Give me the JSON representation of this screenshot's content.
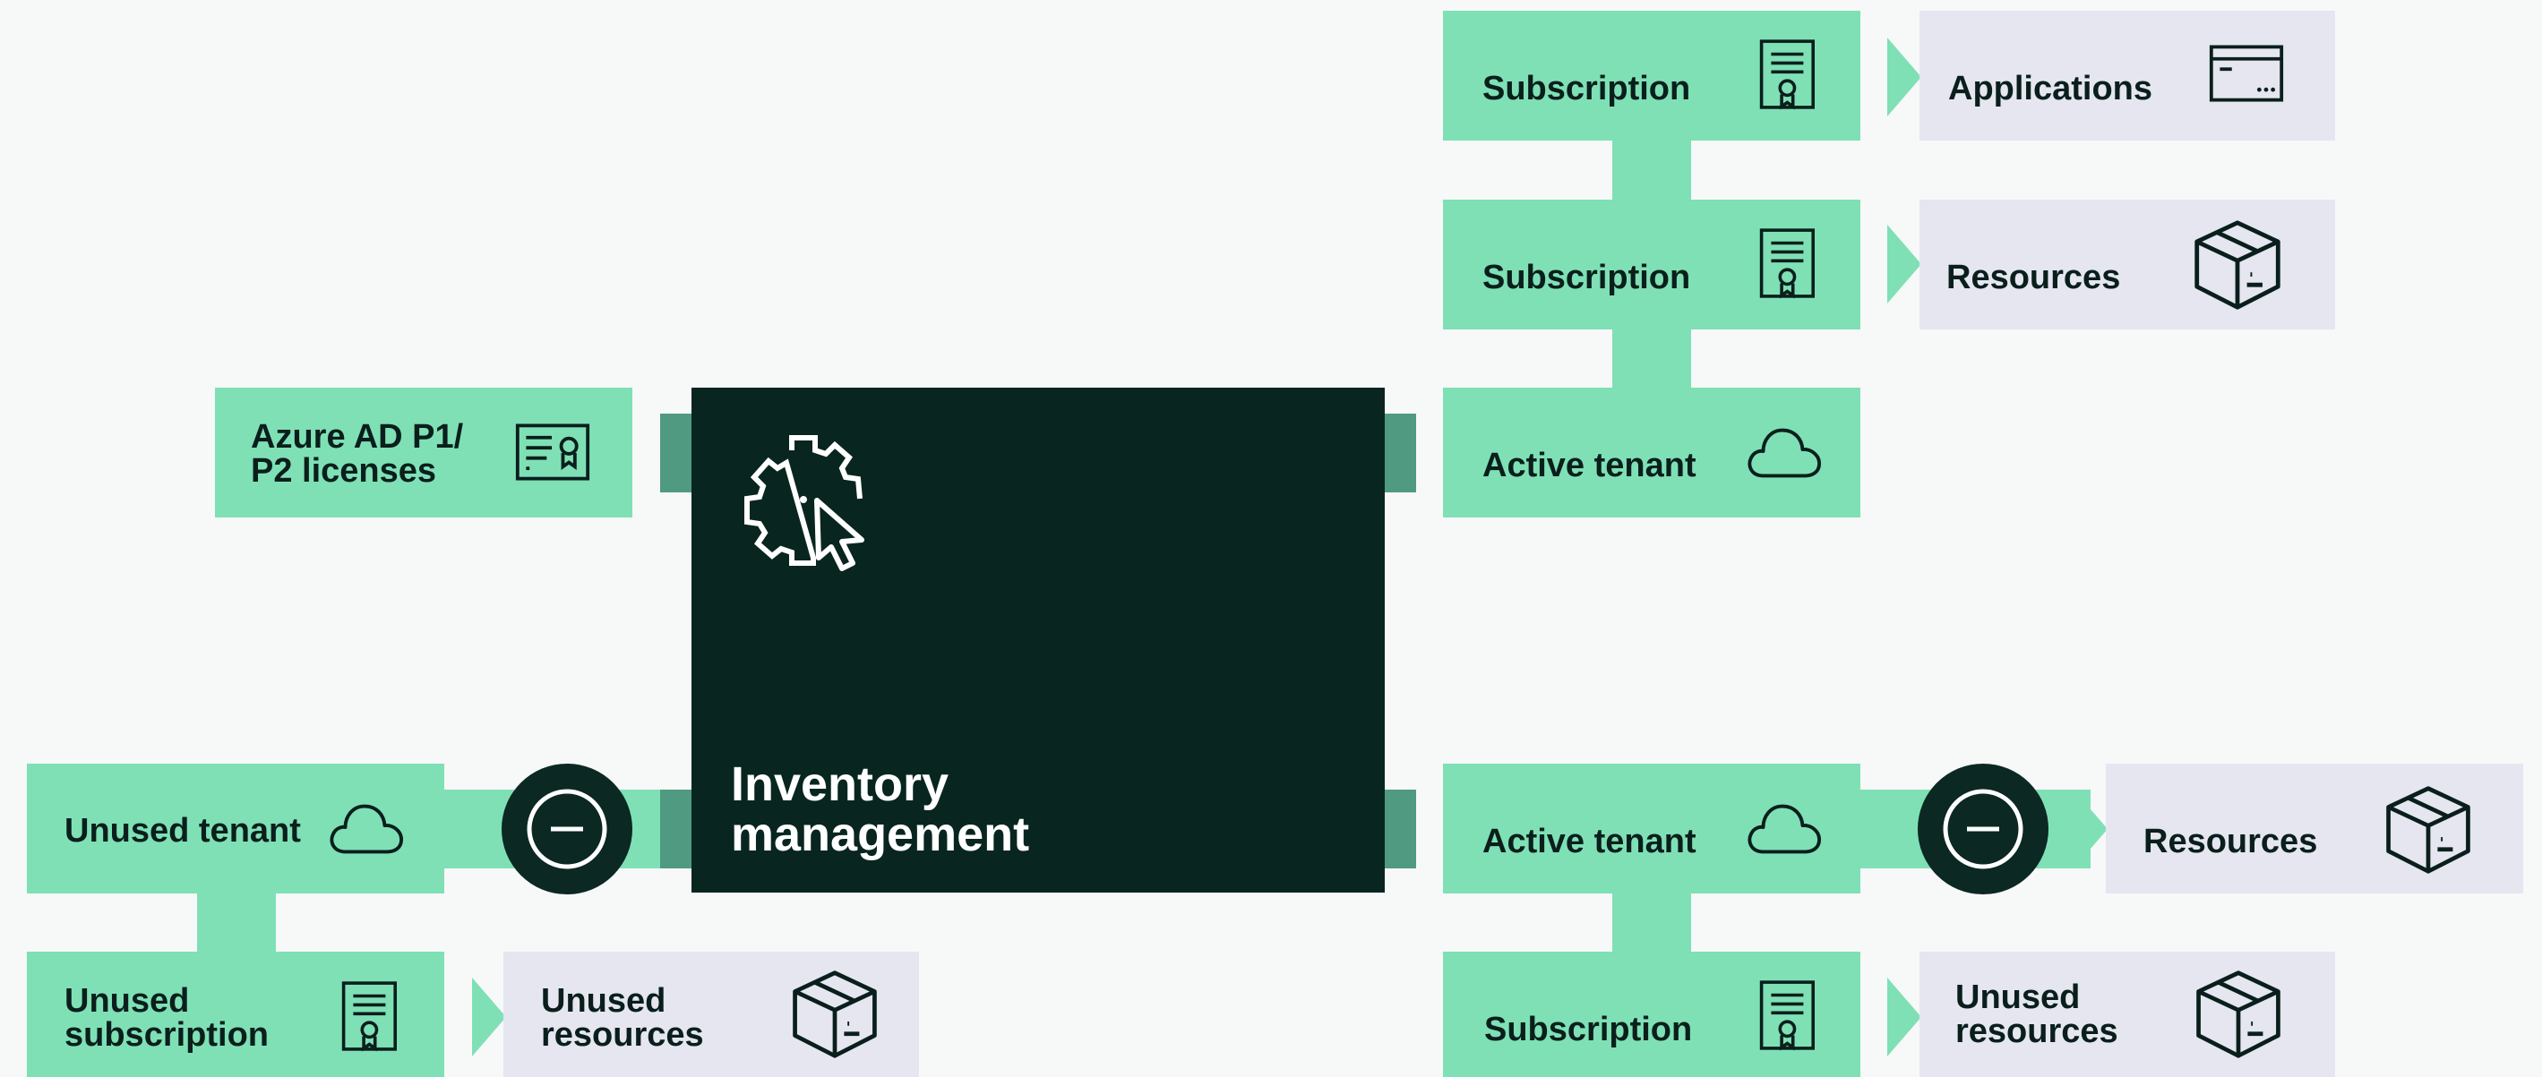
{
  "central": {
    "title": "Inventory\nmanagement",
    "icon": "gear-cursor-icon"
  },
  "left": {
    "azure_licenses": {
      "label": "Azure AD P1/\nP2 licenses",
      "icon": "certificate-icon"
    },
    "unused_tenant": {
      "label": "Unused tenant",
      "icon": "cloud-icon"
    },
    "unused_subscription": {
      "label": "Unused\nsubscription",
      "icon": "document-ribbon-icon"
    },
    "unused_resources": {
      "label": "Unused\nresources",
      "icon": "box-icon"
    }
  },
  "right_top": {
    "subscription_1": {
      "label": "Subscription",
      "icon": "document-ribbon-icon"
    },
    "applications": {
      "label": "Applications",
      "icon": "app-window-icon"
    },
    "subscription_2": {
      "label": "Subscription",
      "icon": "document-ribbon-icon"
    },
    "resources_1": {
      "label": "Resources",
      "icon": "box-icon"
    },
    "active_tenant_1": {
      "label": "Active tenant",
      "icon": "cloud-icon"
    }
  },
  "right_bottom": {
    "active_tenant_2": {
      "label": "Active tenant",
      "icon": "cloud-icon"
    },
    "resources_2": {
      "label": "Resources",
      "icon": "box-icon"
    },
    "subscription_3": {
      "label": "Subscription",
      "icon": "document-ribbon-icon"
    },
    "unused_resources_2": {
      "label": "Unused\nresources",
      "icon": "box-icon"
    }
  },
  "nodes": {
    "minus_icon": "minus-circle-icon"
  },
  "colors": {
    "green": "#7fe0b6",
    "dark": "#08261f",
    "lavender": "#e5e6f0",
    "connector_dark": "#4f9a80"
  }
}
